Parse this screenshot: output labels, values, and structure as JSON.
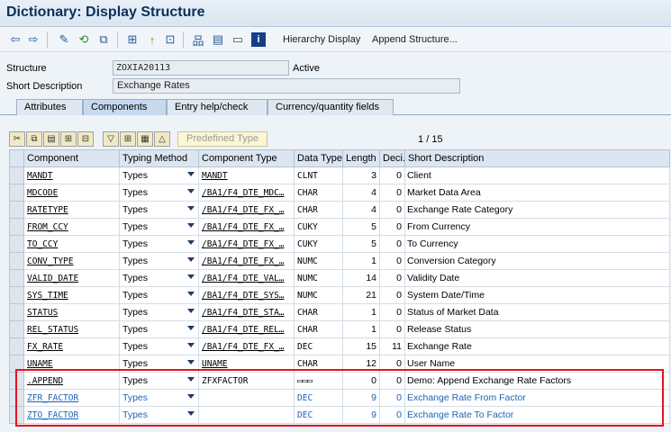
{
  "window": {
    "title": "Dictionary: Display Structure"
  },
  "toolbar": {
    "icons": [
      "back-icon",
      "forward-icon",
      "other-object-icon",
      "display-change-icon",
      "where-used-icon",
      "object-list-icon",
      "activate-icon",
      "check-icon",
      "hierarchy-icon",
      "print-icon",
      "info-icon"
    ],
    "hierarchy_label": "Hierarchy Display",
    "append_label": "Append Structure..."
  },
  "form": {
    "structure_label": "Structure",
    "structure_value": "ZOXIA20113",
    "status": "Active",
    "short_desc_label": "Short Description",
    "short_desc_value": "Exchange Rates"
  },
  "tabs": [
    "Attributes",
    "Components",
    "Entry help/check",
    "Currency/quantity fields"
  ],
  "active_tab": "Components",
  "grid_toolbar": {
    "predefined_label": "Predefined Type",
    "page_current": "1",
    "page_sep": "/",
    "page_total": "15"
  },
  "columns": [
    "Component",
    "Typing Method",
    "Component Type",
    "Data Type",
    "Length",
    "Deci...",
    "Short Description"
  ],
  "rows": [
    {
      "comp": "MANDT",
      "method": "Types",
      "ctype": "MANDT",
      "dtype": "CLNT",
      "len": "3",
      "dec": "0",
      "desc": "Client"
    },
    {
      "comp": "MDCODE",
      "method": "Types",
      "ctype": "/BA1/F4_DTE_MDC…",
      "dtype": "CHAR",
      "len": "4",
      "dec": "0",
      "desc": "Market Data Area"
    },
    {
      "comp": "RATETYPE",
      "method": "Types",
      "ctype": "/BA1/F4_DTE_FX_…",
      "dtype": "CHAR",
      "len": "4",
      "dec": "0",
      "desc": "Exchange Rate Category"
    },
    {
      "comp": "FROM_CCY",
      "method": "Types",
      "ctype": "/BA1/F4_DTE_FX_…",
      "dtype": "CUKY",
      "len": "5",
      "dec": "0",
      "desc": "From Currency"
    },
    {
      "comp": "TO_CCY",
      "method": "Types",
      "ctype": "/BA1/F4_DTE_FX_…",
      "dtype": "CUKY",
      "len": "5",
      "dec": "0",
      "desc": "To Currency"
    },
    {
      "comp": "CONV_TYPE",
      "method": "Types",
      "ctype": "/BA1/F4_DTE_FX_…",
      "dtype": "NUMC",
      "len": "1",
      "dec": "0",
      "desc": "Conversion Category"
    },
    {
      "comp": "VALID_DATE",
      "method": "Types",
      "ctype": "/BA1/F4_DTE_VAL…",
      "dtype": "NUMC",
      "len": "14",
      "dec": "0",
      "desc": "Validity Date"
    },
    {
      "comp": "SYS_TIME",
      "method": "Types",
      "ctype": "/BA1/F4_DTE_SYS…",
      "dtype": "NUMC",
      "len": "21",
      "dec": "0",
      "desc": "System Date/Time"
    },
    {
      "comp": "STATUS",
      "method": "Types",
      "ctype": "/BA1/F4_DTE_STA…",
      "dtype": "CHAR",
      "len": "1",
      "dec": "0",
      "desc": "Status of Market Data"
    },
    {
      "comp": "REL_STATUS",
      "method": "Types",
      "ctype": "/BA1/F4_DTE_REL…",
      "dtype": "CHAR",
      "len": "1",
      "dec": "0",
      "desc": "Release Status"
    },
    {
      "comp": "FX_RATE",
      "method": "Types",
      "ctype": "/BA1/F4_DTE_FX_…",
      "dtype": "DEC",
      "len": "15",
      "dec": "11",
      "desc": "Exchange Rate"
    },
    {
      "comp": "UNAME",
      "method": "Types",
      "ctype": "UNAME",
      "dtype": "CHAR",
      "len": "12",
      "dec": "0",
      "desc": "User Name"
    },
    {
      "comp": ".APPEND",
      "method": "Types",
      "ctype": "ZFXFACTOR",
      "dtype": "▭▭▭",
      "len": "0",
      "dec": "0",
      "desc": "Demo: Append Exchange Rate Factors"
    },
    {
      "comp": "ZFR_FACTOR",
      "method": "Types",
      "ctype": "",
      "dtype": "DEC",
      "len": "9",
      "dec": "0",
      "desc": "Exchange Rate From Factor"
    },
    {
      "comp": "ZTO_FACTOR",
      "method": "Types",
      "ctype": "",
      "dtype": "DEC",
      "len": "9",
      "dec": "0",
      "desc": "Exchange Rate To Factor"
    }
  ],
  "colors": {
    "highlight": "#e0151f",
    "append_text": "#1d63b8"
  }
}
